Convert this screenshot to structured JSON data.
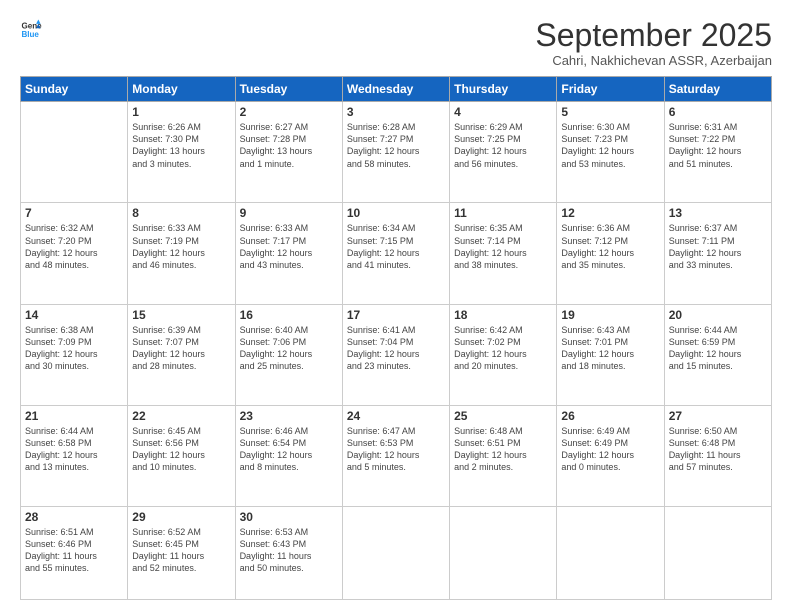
{
  "header": {
    "logo_general": "General",
    "logo_blue": "Blue",
    "month_title": "September 2025",
    "location": "Cahri, Nakhichevan ASSR, Azerbaijan"
  },
  "days_of_week": [
    "Sunday",
    "Monday",
    "Tuesday",
    "Wednesday",
    "Thursday",
    "Friday",
    "Saturday"
  ],
  "weeks": [
    [
      {
        "day": "",
        "info": ""
      },
      {
        "day": "1",
        "info": "Sunrise: 6:26 AM\nSunset: 7:30 PM\nDaylight: 13 hours\nand 3 minutes."
      },
      {
        "day": "2",
        "info": "Sunrise: 6:27 AM\nSunset: 7:28 PM\nDaylight: 13 hours\nand 1 minute."
      },
      {
        "day": "3",
        "info": "Sunrise: 6:28 AM\nSunset: 7:27 PM\nDaylight: 12 hours\nand 58 minutes."
      },
      {
        "day": "4",
        "info": "Sunrise: 6:29 AM\nSunset: 7:25 PM\nDaylight: 12 hours\nand 56 minutes."
      },
      {
        "day": "5",
        "info": "Sunrise: 6:30 AM\nSunset: 7:23 PM\nDaylight: 12 hours\nand 53 minutes."
      },
      {
        "day": "6",
        "info": "Sunrise: 6:31 AM\nSunset: 7:22 PM\nDaylight: 12 hours\nand 51 minutes."
      }
    ],
    [
      {
        "day": "7",
        "info": "Sunrise: 6:32 AM\nSunset: 7:20 PM\nDaylight: 12 hours\nand 48 minutes."
      },
      {
        "day": "8",
        "info": "Sunrise: 6:33 AM\nSunset: 7:19 PM\nDaylight: 12 hours\nand 46 minutes."
      },
      {
        "day": "9",
        "info": "Sunrise: 6:33 AM\nSunset: 7:17 PM\nDaylight: 12 hours\nand 43 minutes."
      },
      {
        "day": "10",
        "info": "Sunrise: 6:34 AM\nSunset: 7:15 PM\nDaylight: 12 hours\nand 41 minutes."
      },
      {
        "day": "11",
        "info": "Sunrise: 6:35 AM\nSunset: 7:14 PM\nDaylight: 12 hours\nand 38 minutes."
      },
      {
        "day": "12",
        "info": "Sunrise: 6:36 AM\nSunset: 7:12 PM\nDaylight: 12 hours\nand 35 minutes."
      },
      {
        "day": "13",
        "info": "Sunrise: 6:37 AM\nSunset: 7:11 PM\nDaylight: 12 hours\nand 33 minutes."
      }
    ],
    [
      {
        "day": "14",
        "info": "Sunrise: 6:38 AM\nSunset: 7:09 PM\nDaylight: 12 hours\nand 30 minutes."
      },
      {
        "day": "15",
        "info": "Sunrise: 6:39 AM\nSunset: 7:07 PM\nDaylight: 12 hours\nand 28 minutes."
      },
      {
        "day": "16",
        "info": "Sunrise: 6:40 AM\nSunset: 7:06 PM\nDaylight: 12 hours\nand 25 minutes."
      },
      {
        "day": "17",
        "info": "Sunrise: 6:41 AM\nSunset: 7:04 PM\nDaylight: 12 hours\nand 23 minutes."
      },
      {
        "day": "18",
        "info": "Sunrise: 6:42 AM\nSunset: 7:02 PM\nDaylight: 12 hours\nand 20 minutes."
      },
      {
        "day": "19",
        "info": "Sunrise: 6:43 AM\nSunset: 7:01 PM\nDaylight: 12 hours\nand 18 minutes."
      },
      {
        "day": "20",
        "info": "Sunrise: 6:44 AM\nSunset: 6:59 PM\nDaylight: 12 hours\nand 15 minutes."
      }
    ],
    [
      {
        "day": "21",
        "info": "Sunrise: 6:44 AM\nSunset: 6:58 PM\nDaylight: 12 hours\nand 13 minutes."
      },
      {
        "day": "22",
        "info": "Sunrise: 6:45 AM\nSunset: 6:56 PM\nDaylight: 12 hours\nand 10 minutes."
      },
      {
        "day": "23",
        "info": "Sunrise: 6:46 AM\nSunset: 6:54 PM\nDaylight: 12 hours\nand 8 minutes."
      },
      {
        "day": "24",
        "info": "Sunrise: 6:47 AM\nSunset: 6:53 PM\nDaylight: 12 hours\nand 5 minutes."
      },
      {
        "day": "25",
        "info": "Sunrise: 6:48 AM\nSunset: 6:51 PM\nDaylight: 12 hours\nand 2 minutes."
      },
      {
        "day": "26",
        "info": "Sunrise: 6:49 AM\nSunset: 6:49 PM\nDaylight: 12 hours\nand 0 minutes."
      },
      {
        "day": "27",
        "info": "Sunrise: 6:50 AM\nSunset: 6:48 PM\nDaylight: 11 hours\nand 57 minutes."
      }
    ],
    [
      {
        "day": "28",
        "info": "Sunrise: 6:51 AM\nSunset: 6:46 PM\nDaylight: 11 hours\nand 55 minutes."
      },
      {
        "day": "29",
        "info": "Sunrise: 6:52 AM\nSunset: 6:45 PM\nDaylight: 11 hours\nand 52 minutes."
      },
      {
        "day": "30",
        "info": "Sunrise: 6:53 AM\nSunset: 6:43 PM\nDaylight: 11 hours\nand 50 minutes."
      },
      {
        "day": "",
        "info": ""
      },
      {
        "day": "",
        "info": ""
      },
      {
        "day": "",
        "info": ""
      },
      {
        "day": "",
        "info": ""
      }
    ]
  ]
}
